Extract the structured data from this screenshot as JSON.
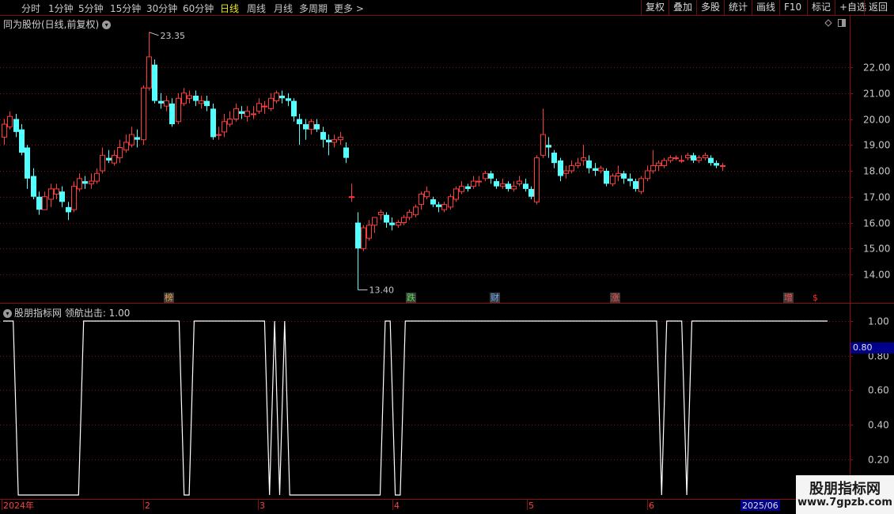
{
  "toolbar": {
    "periods": [
      "分时",
      "1分钟",
      "5分钟",
      "15分钟",
      "30分钟",
      "60分钟",
      "日线",
      "周线",
      "月线",
      "多周期",
      "更多 >"
    ],
    "active_period": "日线",
    "actions": [
      "复权",
      "叠加",
      "多股",
      "统计",
      "画线",
      "F10",
      "标记",
      "+自选",
      "返回"
    ]
  },
  "main_chart": {
    "title": "同为股份(日线,前复权)",
    "high_label": "23.35",
    "low_label": "13.40",
    "events": [
      {
        "text": "榜",
        "color": "#e8a050"
      },
      {
        "text": "跌",
        "color": "#50e050"
      },
      {
        "text": "财",
        "color": "#60a8ff"
      },
      {
        "text": "涨",
        "color": "#ff5050"
      },
      {
        "text": "增",
        "color": "#ff5050"
      },
      {
        "text": "$",
        "color": "#ff3030"
      }
    ],
    "y_ticks": [
      "22.00",
      "21.00",
      "20.00",
      "19.00",
      "18.00",
      "17.00",
      "16.00",
      "15.00",
      "14.00"
    ]
  },
  "indicator": {
    "title": "股朋指标网  领航出击: 1.00",
    "current_value": "0.80",
    "y_ticks": [
      "1.00",
      "0.80",
      "0.60",
      "0.40",
      "0.20"
    ]
  },
  "date_axis": {
    "labels": [
      "2024年",
      "2",
      "3",
      "4",
      "5",
      "6"
    ],
    "current_label": "2025/06"
  },
  "watermark": {
    "title": "股朋指标网",
    "url": "www.7gpzb.com"
  },
  "colors": {
    "up": "#ff3b3b",
    "down": "#54ffff",
    "grid": "#8a1010",
    "indicator_line": "#ffffff",
    "active": "#e8e820"
  },
  "chart_data": {
    "type": "candlestick",
    "series": [
      {
        "name": "K线",
        "candles": [
          [
            19.3,
            19.8,
            20.0,
            19.0
          ],
          [
            19.7,
            20.1,
            20.3,
            19.6
          ],
          [
            20.0,
            19.5,
            20.2,
            19.3
          ],
          [
            19.6,
            18.7,
            19.8,
            18.6
          ],
          [
            18.9,
            17.7,
            19.0,
            17.3
          ],
          [
            17.8,
            17.0,
            18.1,
            16.9
          ],
          [
            17.0,
            16.5,
            17.2,
            16.3
          ],
          [
            16.5,
            17.0,
            17.2,
            16.5
          ],
          [
            16.9,
            17.3,
            17.5,
            16.6
          ],
          [
            17.1,
            17.3,
            17.5,
            16.9
          ],
          [
            17.2,
            16.8,
            17.4,
            16.6
          ],
          [
            16.6,
            16.4,
            16.8,
            16.1
          ],
          [
            16.5,
            17.4,
            17.6,
            16.4
          ],
          [
            17.3,
            17.7,
            17.9,
            17.2
          ],
          [
            17.6,
            17.5,
            17.8,
            17.3
          ],
          [
            17.5,
            17.6,
            17.9,
            17.3
          ],
          [
            17.6,
            17.9,
            18.1,
            17.5
          ],
          [
            18.0,
            18.6,
            18.9,
            17.9
          ],
          [
            18.5,
            18.4,
            18.8,
            18.3
          ],
          [
            18.3,
            18.6,
            18.8,
            18.2
          ],
          [
            18.5,
            18.9,
            19.2,
            18.3
          ],
          [
            18.8,
            19.1,
            19.4,
            18.7
          ],
          [
            19.0,
            19.4,
            19.7,
            18.9
          ],
          [
            19.3,
            19.2,
            19.6,
            18.9
          ],
          [
            19.2,
            21.2,
            21.3,
            19.0
          ],
          [
            21.2,
            22.4,
            23.35,
            21.1
          ],
          [
            22.1,
            20.7,
            22.3,
            20.6
          ],
          [
            20.7,
            20.6,
            21.0,
            20.4
          ],
          [
            20.5,
            20.7,
            20.9,
            20.3
          ],
          [
            20.6,
            19.8,
            20.8,
            19.7
          ],
          [
            19.9,
            20.8,
            21.0,
            19.8
          ],
          [
            20.6,
            21.0,
            21.2,
            20.5
          ],
          [
            20.8,
            20.9,
            21.1,
            20.6
          ],
          [
            20.9,
            20.7,
            21.1,
            20.5
          ],
          [
            20.6,
            20.7,
            20.9,
            20.4
          ],
          [
            20.7,
            20.5,
            20.9,
            20.3
          ],
          [
            20.4,
            19.3,
            20.6,
            19.2
          ],
          [
            19.4,
            19.4,
            19.7,
            19.2
          ],
          [
            19.5,
            19.9,
            20.2,
            19.3
          ],
          [
            19.8,
            20.0,
            20.3,
            19.7
          ],
          [
            20.0,
            20.4,
            20.6,
            19.9
          ],
          [
            20.3,
            20.2,
            20.5,
            20.0
          ],
          [
            20.1,
            20.3,
            20.5,
            19.9
          ],
          [
            20.2,
            20.2,
            20.5,
            20.0
          ],
          [
            20.3,
            20.6,
            20.8,
            20.2
          ],
          [
            20.5,
            20.5,
            20.7,
            20.2
          ],
          [
            20.4,
            20.8,
            21.0,
            20.3
          ],
          [
            20.7,
            21.0,
            21.1,
            20.6
          ],
          [
            20.9,
            20.8,
            21.1,
            20.6
          ],
          [
            20.8,
            20.7,
            21.0,
            20.5
          ],
          [
            20.7,
            20.1,
            20.8,
            19.9
          ],
          [
            20.0,
            19.8,
            20.2,
            19.0
          ],
          [
            19.8,
            19.6,
            20.0,
            19.2
          ],
          [
            19.6,
            19.9,
            20.0,
            19.4
          ],
          [
            19.8,
            19.6,
            20.0,
            19.5
          ],
          [
            19.5,
            19.2,
            19.7,
            18.9
          ],
          [
            19.2,
            19.1,
            19.4,
            18.6
          ],
          [
            19.1,
            19.2,
            19.4,
            18.9
          ],
          [
            19.2,
            19.3,
            19.5,
            19.0
          ],
          [
            18.9,
            18.5,
            19.1,
            18.3
          ],
          [
            17.0,
            17.0,
            17.5,
            16.8
          ],
          [
            16.0,
            15.0,
            16.4,
            13.4
          ],
          [
            15.0,
            15.8,
            15.9,
            14.9
          ],
          [
            15.4,
            15.9,
            16.1,
            15.3
          ],
          [
            15.9,
            16.2,
            16.2,
            15.6
          ],
          [
            16.3,
            16.4,
            16.5,
            16.1
          ],
          [
            16.3,
            16.0,
            16.4,
            15.8
          ],
          [
            16.0,
            15.9,
            16.2,
            15.7
          ],
          [
            15.9,
            16.0,
            16.1,
            15.8
          ],
          [
            16.0,
            16.2,
            16.3,
            15.9
          ],
          [
            16.2,
            16.4,
            16.5,
            16.1
          ],
          [
            16.3,
            16.6,
            16.7,
            16.2
          ],
          [
            16.7,
            17.1,
            17.2,
            16.5
          ],
          [
            17.0,
            17.2,
            17.4,
            16.9
          ],
          [
            16.9,
            16.7,
            17.0,
            16.6
          ],
          [
            16.7,
            16.6,
            16.8,
            16.4
          ],
          [
            16.5,
            16.7,
            16.8,
            16.4
          ],
          [
            16.6,
            17.0,
            17.1,
            16.5
          ],
          [
            16.9,
            17.3,
            17.4,
            16.8
          ],
          [
            17.2,
            17.4,
            17.6,
            17.1
          ],
          [
            17.4,
            17.3,
            17.5,
            17.2
          ],
          [
            17.4,
            17.6,
            17.8,
            17.3
          ],
          [
            17.6,
            17.6,
            17.8,
            17.4
          ],
          [
            17.7,
            17.9,
            18.0,
            17.6
          ],
          [
            17.9,
            17.7,
            18.0,
            17.5
          ],
          [
            17.6,
            17.4,
            17.7,
            17.3
          ],
          [
            17.4,
            17.5,
            17.7,
            17.3
          ],
          [
            17.5,
            17.3,
            17.6,
            17.2
          ],
          [
            17.3,
            17.4,
            17.6,
            17.2
          ],
          [
            17.5,
            17.6,
            17.8,
            17.4
          ],
          [
            17.5,
            17.3,
            17.7,
            17.2
          ],
          [
            17.3,
            17.0,
            17.4,
            16.9
          ],
          [
            16.8,
            18.5,
            18.6,
            16.7
          ],
          [
            18.6,
            19.4,
            20.4,
            18.5
          ],
          [
            19.0,
            18.9,
            19.3,
            18.5
          ],
          [
            18.7,
            18.3,
            18.8,
            18.1
          ],
          [
            18.4,
            17.8,
            18.5,
            17.6
          ],
          [
            17.9,
            18.0,
            18.2,
            17.7
          ],
          [
            18.0,
            18.2,
            18.4,
            17.9
          ],
          [
            18.2,
            18.3,
            18.5,
            18.1
          ],
          [
            18.4,
            18.5,
            19.0,
            18.2
          ],
          [
            18.4,
            18.1,
            18.6,
            17.9
          ],
          [
            18.1,
            18.0,
            18.3,
            17.8
          ],
          [
            18.0,
            18.1,
            18.2,
            17.9
          ],
          [
            18.0,
            17.5,
            18.1,
            17.4
          ],
          [
            17.5,
            17.8,
            17.9,
            17.4
          ],
          [
            17.8,
            17.9,
            18.2,
            17.6
          ],
          [
            17.9,
            17.7,
            18.0,
            17.5
          ],
          [
            17.7,
            17.6,
            17.9,
            17.4
          ],
          [
            17.6,
            17.3,
            17.7,
            17.2
          ],
          [
            17.2,
            17.7,
            17.8,
            17.1
          ],
          [
            17.7,
            18.0,
            18.2,
            17.6
          ],
          [
            18.0,
            18.2,
            18.8,
            17.9
          ],
          [
            18.2,
            18.3,
            18.4,
            18.0
          ],
          [
            18.2,
            18.4,
            18.5,
            18.1
          ],
          [
            18.4,
            18.5,
            18.6,
            18.3
          ],
          [
            18.5,
            18.5,
            18.6,
            18.4
          ],
          [
            18.4,
            18.4,
            18.6,
            18.3
          ],
          [
            18.5,
            18.6,
            18.7,
            18.4
          ],
          [
            18.6,
            18.4,
            18.7,
            18.3
          ],
          [
            18.4,
            18.5,
            18.6,
            18.3
          ],
          [
            18.5,
            18.6,
            18.7,
            18.4
          ],
          [
            18.5,
            18.3,
            18.6,
            18.2
          ],
          [
            18.3,
            18.2,
            18.4,
            18.1
          ],
          [
            18.2,
            18.2,
            18.3,
            18.0
          ]
        ]
      },
      {
        "name": "领航出击",
        "values": [
          1,
          1,
          1,
          0,
          0,
          0,
          0,
          0,
          0,
          0,
          0,
          0,
          0,
          0,
          0,
          0,
          1,
          1,
          1,
          1,
          1,
          1,
          1,
          1,
          1,
          1,
          1,
          1,
          1,
          1,
          1,
          1,
          1,
          1,
          1,
          1,
          0,
          0,
          1,
          1,
          1,
          1,
          1,
          1,
          1,
          1,
          1,
          1,
          1,
          1,
          1,
          1,
          1,
          0,
          1,
          0,
          1,
          0,
          0,
          0,
          0,
          0,
          0,
          0,
          0,
          0,
          0,
          0,
          0,
          0,
          0,
          0,
          0,
          0,
          0,
          0,
          1,
          1,
          0,
          0,
          1,
          1,
          1,
          1,
          1,
          1,
          1,
          1,
          1,
          1,
          1,
          1,
          1,
          1,
          1,
          1,
          1,
          1,
          1,
          1,
          1,
          1,
          1,
          1,
          1,
          1,
          1,
          1,
          1,
          1,
          1,
          1,
          1,
          1,
          1,
          1,
          1,
          1,
          1,
          1,
          1,
          1,
          1,
          1,
          1,
          1,
          1,
          1,
          1,
          1,
          1,
          0,
          1,
          1,
          1,
          1,
          0,
          1,
          1,
          1,
          1,
          1,
          1,
          1,
          1,
          1,
          1,
          1,
          1,
          1,
          1,
          1,
          1,
          1,
          1,
          1,
          1,
          1,
          1,
          1,
          1,
          1,
          1,
          1,
          1
        ]
      }
    ],
    "price_ylim": [
      13.4,
      23.35
    ],
    "indicator_ylim": [
      0,
      1
    ]
  }
}
